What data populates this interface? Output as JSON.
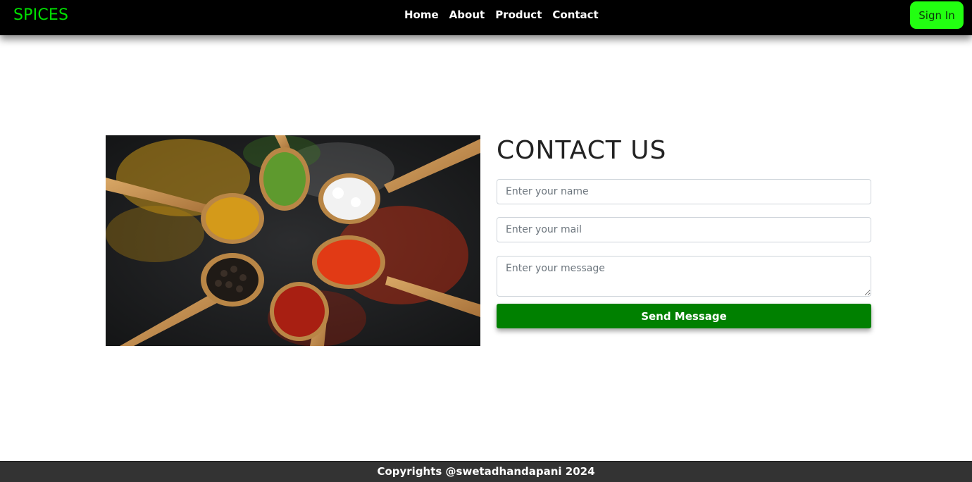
{
  "navbar": {
    "brand": "SPICES",
    "links": [
      "Home",
      "About",
      "Product",
      "Contact"
    ],
    "signin_label": "Sign In"
  },
  "contact": {
    "title": "CONTACT US",
    "name_placeholder": "Enter your name",
    "mail_placeholder": "Enter your mail",
    "message_placeholder": "Enter your message",
    "send_label": "Send Message"
  },
  "footer": {
    "text": "Copyrights @swetadhandapani 2024"
  },
  "colors": {
    "brand": "#00e000",
    "signin_bg": "#22ff11",
    "send_bg": "#008000",
    "navbar_bg": "#000000",
    "footer_bg": "#333333"
  }
}
